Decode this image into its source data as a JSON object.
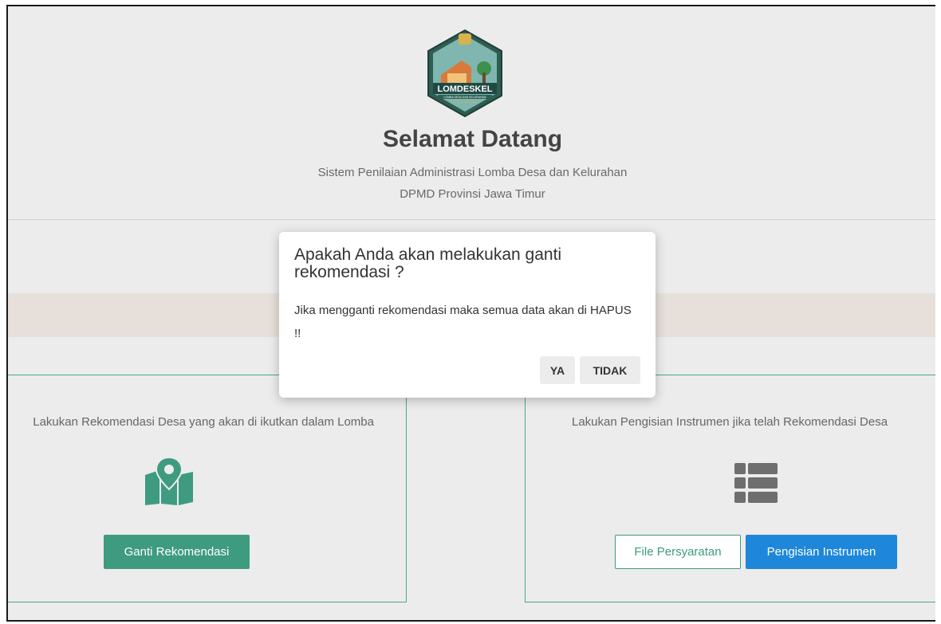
{
  "header": {
    "logo_text": "LOMDESKEL",
    "logo_subtext": "LOMBA DESA DAN KELURAHAN",
    "logo_province": "PROVINSI JAWA TIMUR",
    "title": "Selamat Datang",
    "subtitle_line1": "Sistem Penilaian Administrasi Lomba Desa dan Kelurahan",
    "subtitle_line2": "DPMD Provinsi Jawa Timur"
  },
  "cards": {
    "left": {
      "text": "Lakukan Rekomendasi Desa yang akan di ikutkan dalam Lomba",
      "icon": "map-marker-icon",
      "button_label": "Ganti Rekomendasi"
    },
    "right": {
      "text": "Lakukan Pengisian Instrumen jika telah Rekomendasi Desa",
      "icon": "list-table-icon",
      "file_button_label": "File Persyaratan",
      "instrument_button_label": "Pengisian Instrumen"
    }
  },
  "modal": {
    "title": "Apakah Anda akan melakukan ganti rekomendasi ?",
    "body": "Jika mengganti rekomendasi maka semua data akan di HAPUS !!",
    "yes_label": "YA",
    "no_label": "TIDAK"
  },
  "colors": {
    "accent_green": "#3e9b80",
    "accent_blue": "#1e87da",
    "overlay_bg": "#ececec"
  }
}
